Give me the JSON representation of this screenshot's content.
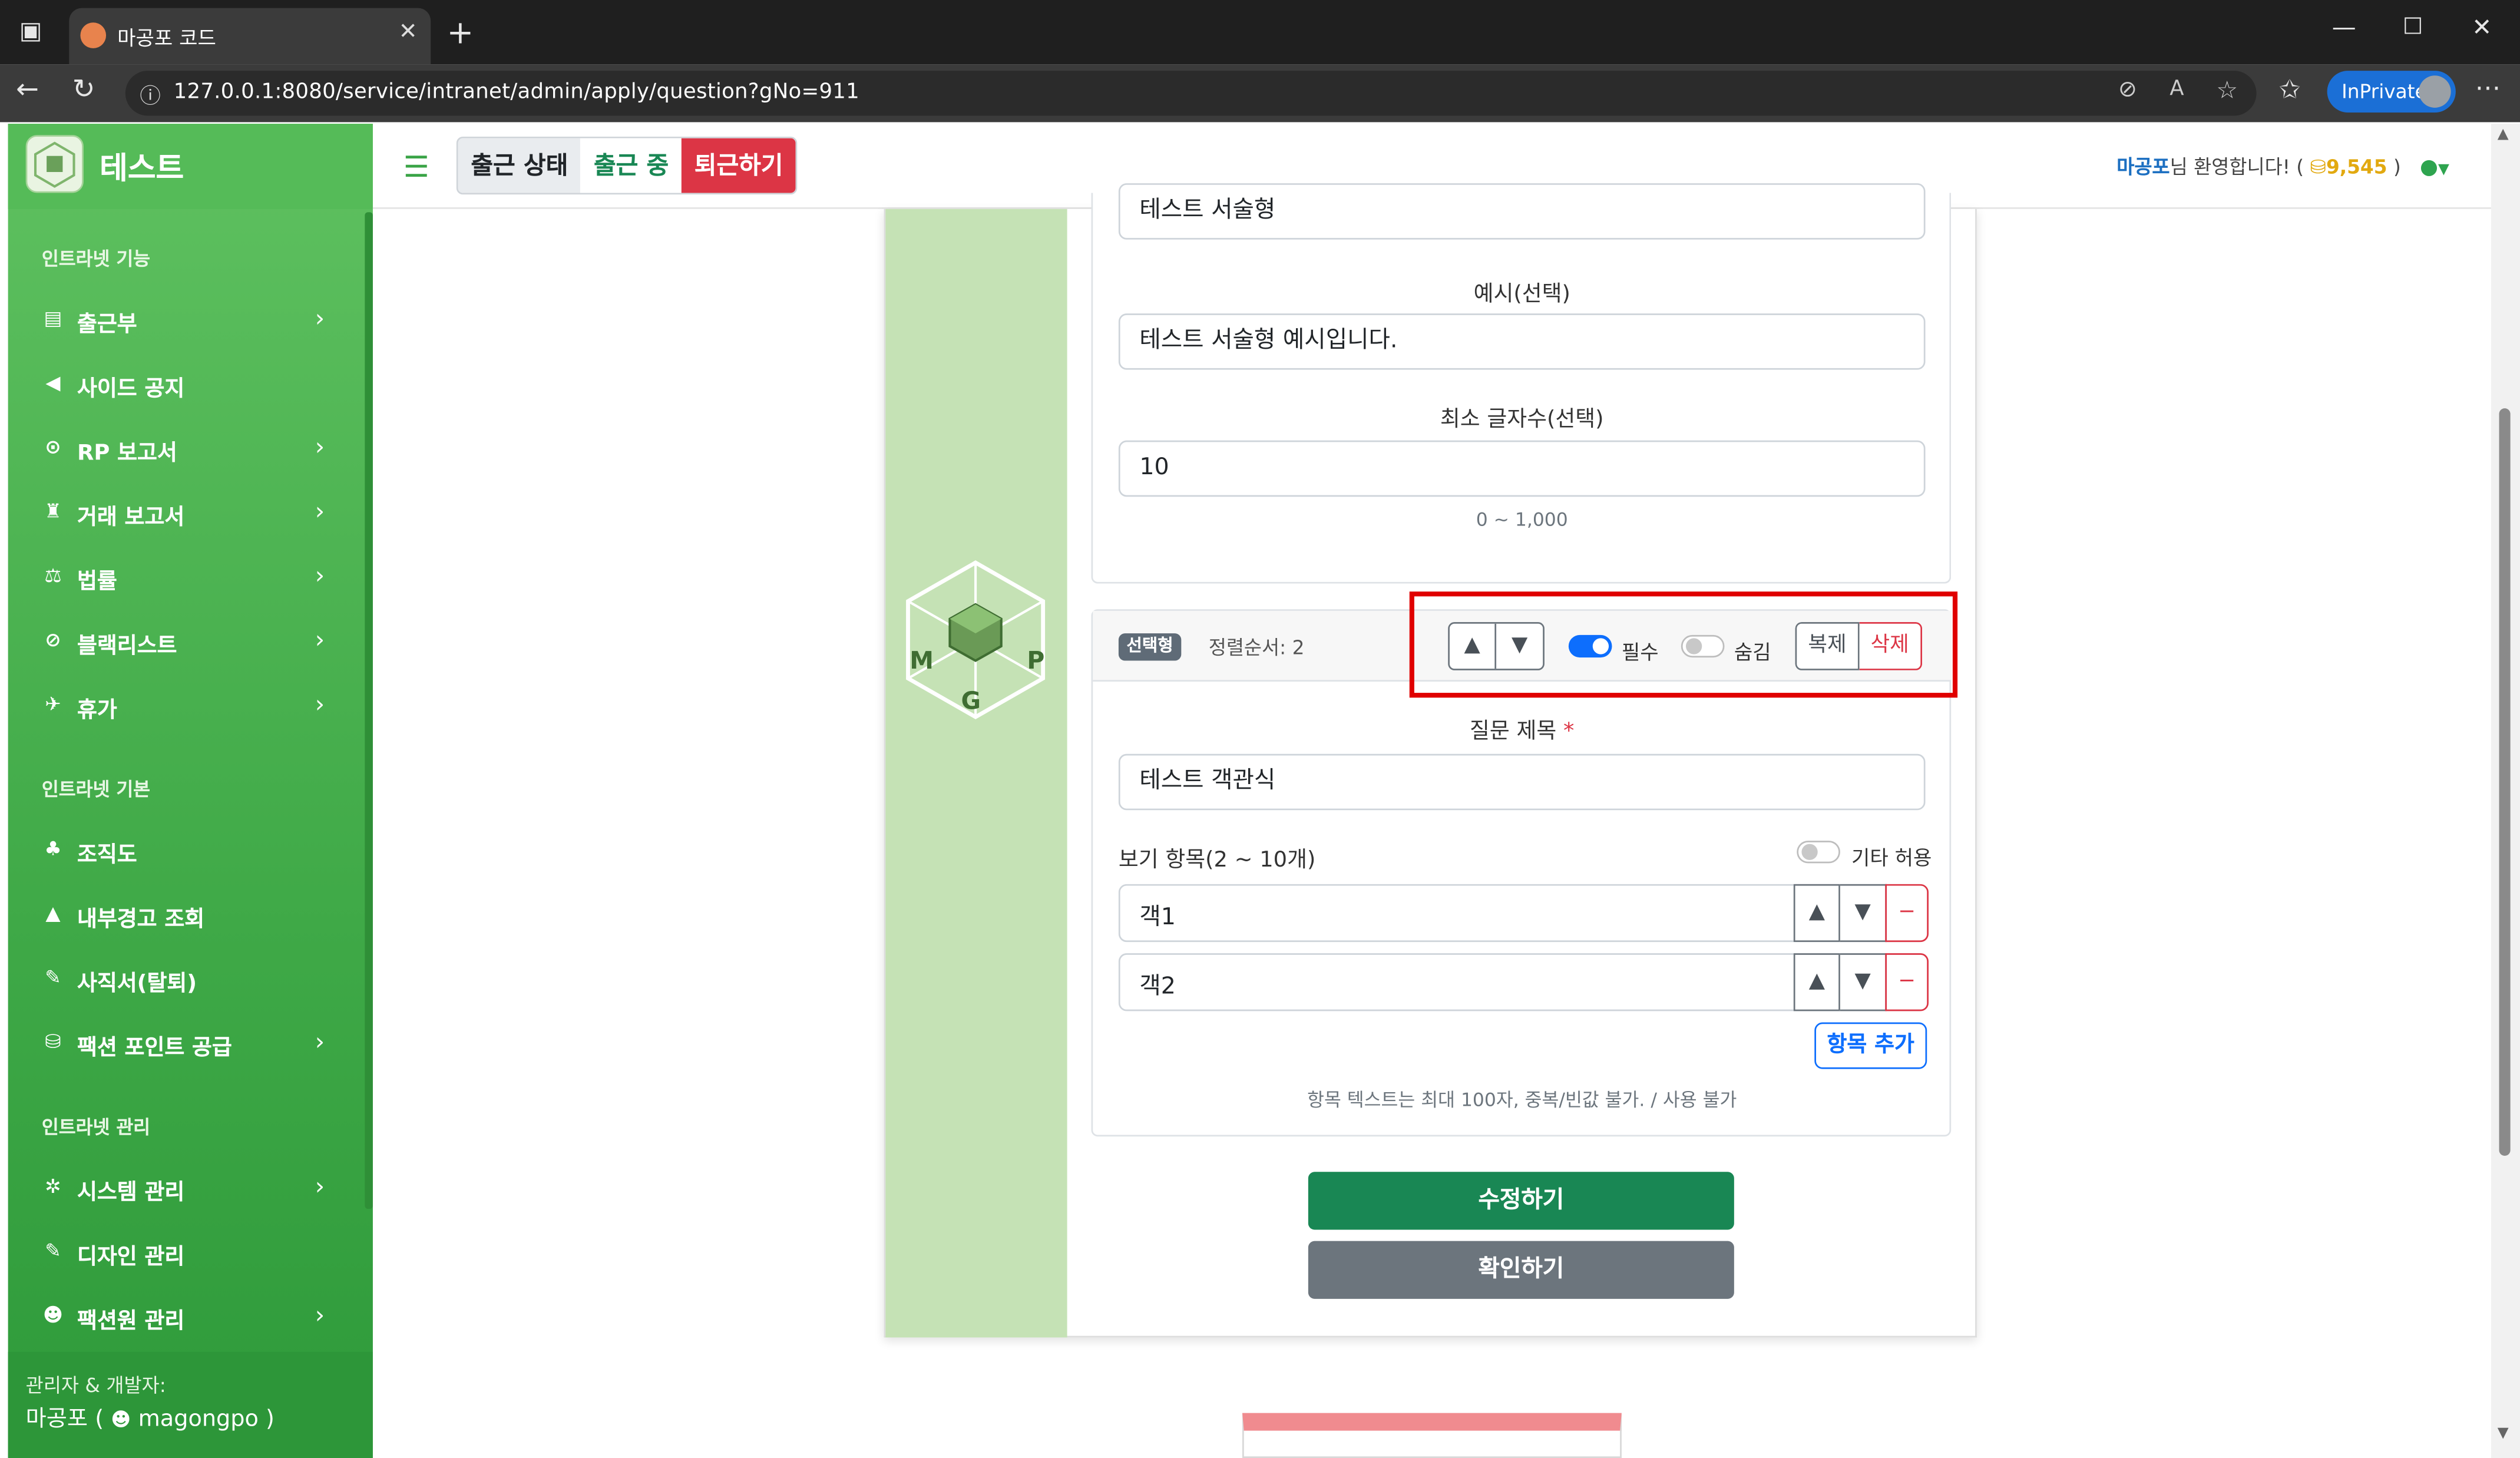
{
  "browser": {
    "tab_title": "마공포 코드",
    "url": "127.0.0.1:8080/service/intranet/admin/apply/question?gNo=911",
    "inprivate_label": "InPrivate"
  },
  "sidebar": {
    "brand": "테스트",
    "section1": "인트라넷 기능",
    "items1": [
      {
        "label": "출근부",
        "icon": "book-icon",
        "chevron": true
      },
      {
        "label": "사이드 공지",
        "icon": "megaphone-icon",
        "chevron": false
      },
      {
        "label": "RP 보고서",
        "icon": "toggle-icon",
        "chevron": true
      },
      {
        "label": "거래 보고서",
        "icon": "bag-icon",
        "chevron": true
      },
      {
        "label": "법률",
        "icon": "scale-icon",
        "chevron": true
      },
      {
        "label": "블랙리스트",
        "icon": "ban-icon",
        "chevron": true
      },
      {
        "label": "휴가",
        "icon": "plane-icon",
        "chevron": true
      }
    ],
    "section2": "인트라넷 기본",
    "items2": [
      {
        "label": "조직도",
        "icon": "org-chart-icon",
        "chevron": false
      },
      {
        "label": "내부경고 조회",
        "icon": "warning-icon",
        "chevron": false
      },
      {
        "label": "사직서(탈퇴)",
        "icon": "pen-icon",
        "chevron": false
      },
      {
        "label": "팩션 포인트 공급",
        "icon": "coins-icon",
        "chevron": true
      }
    ],
    "section3": "인트라넷 관리",
    "items3": [
      {
        "label": "시스템 관리",
        "icon": "gear-icon",
        "chevron": true
      },
      {
        "label": "디자인 관리",
        "icon": "brush-icon",
        "chevron": false
      },
      {
        "label": "팩션원 관리",
        "icon": "users-gear-icon",
        "chevron": true
      }
    ],
    "footer_role": "관리자 & 개발자:",
    "footer_name": "마공포 (",
    "footer_discord": "magongpo )"
  },
  "topbar": {
    "attendance_status": "출근 상태",
    "working": "출근 중",
    "leave_button": "퇴근하기",
    "welcome_name": "마공포",
    "welcome_text": "님 환영합니다! (",
    "points": "9,545",
    "points_close": ")"
  },
  "form": {
    "q1_title_value": "테스트 서술형",
    "example_label": "예시(선택)",
    "example_value": "테스트 서술형 예시입니다.",
    "min_chars_label": "최소 글자수(선택)",
    "min_chars_value": "10",
    "min_chars_hint": "0 ~ 1,000",
    "q2_type_badge": "선택형",
    "q2_sort": "정렬순서: 2",
    "required_label": "필수",
    "hidden_label": "숨김",
    "duplicate_label": "복제",
    "delete_label": "삭제",
    "q2_title_label": "질문 제목",
    "required_mark": "*",
    "q2_title_value": "테스트 객관식",
    "options_label": "보기 항목(2 ~ 10개)",
    "other_allow_label": "기타 허용",
    "options": [
      "객1",
      "객2"
    ],
    "add_option_label": "항목 추가",
    "options_hint": "항목 텍스트는 최대 100자, 중복/빈값 불가. / 사용 불가",
    "edit_button": "수정하기",
    "confirm_button": "확인하기"
  },
  "colors": {
    "sidebar_green": "#43ad4a",
    "accent_blue": "#0d6efd",
    "danger_red": "#dc3545",
    "save_green": "#198754",
    "secondary_gray": "#6c757d",
    "highlight_red": "#e00000"
  }
}
